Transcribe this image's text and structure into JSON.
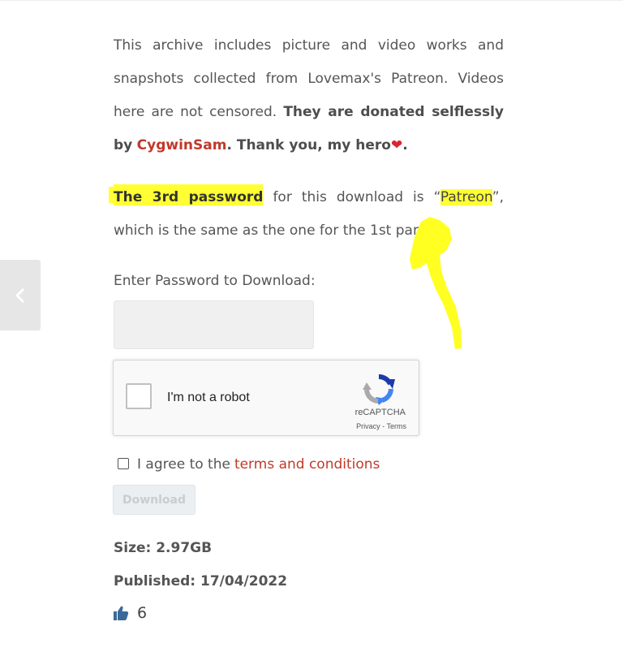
{
  "intro": {
    "text_1": "This archive includes picture and video works and snapshots collected from Lovemax's Patreon. Videos here are not censored. ",
    "bold_1": "They are donated selflessly by",
    "donor_link": "CygwinSam",
    "bold_2": ". Thank you, my hero",
    "heart": "❤",
    "period": "."
  },
  "password_note": {
    "highlight_bold": "The 3rd password",
    "text_1": " for this download is “",
    "password": "Patreon",
    "text_2": "”, which is the same as the one for the 1st part."
  },
  "form": {
    "password_label": "Enter Password to Download:",
    "password_value": "",
    "captcha_label": "I'm not a robot",
    "captcha_brand": "reCAPTCHA",
    "captcha_privacy": "Privacy",
    "captcha_separator": " - ",
    "captcha_terms": "Terms",
    "agree_text": "I agree to the",
    "terms_link": "terms and conditions",
    "download_label": "Download"
  },
  "meta": {
    "size": "Size: 2.97GB",
    "published": "Published: 17/04/2022",
    "likes": "6"
  },
  "colors": {
    "link_red": "#c0392b",
    "highlight": "#ffff33",
    "thumb_blue": "#3a6a9a"
  },
  "icons": {
    "side_nav": "chevron-left-icon",
    "captcha": "recaptcha-logo-icon",
    "likes": "thumbs-up-icon",
    "annotation": "arrow-up-annotation"
  }
}
